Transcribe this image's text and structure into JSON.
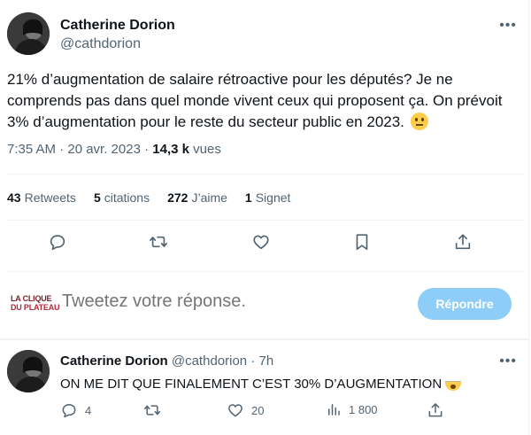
{
  "author": {
    "name": "Catherine Dorion",
    "handle": "@cathdorion"
  },
  "tweet": {
    "text": "21% d’augmentation de salaire rétroactive pour les députés? Je ne comprends pas dans quel monde vivent ceux qui proposent ça. On prévoit 3% d’augmentation pour le reste du secteur public en 2023.",
    "emoji": "neutral-face-emoji",
    "time": "7:35 AM · 20 avr. 2023",
    "separator": "·",
    "views_count": "14,3 k",
    "views_label": "vues"
  },
  "stats": [
    {
      "count": "43",
      "label": "Retweets"
    },
    {
      "count": "5",
      "label": "citations"
    },
    {
      "count": "272",
      "label": "J’aime"
    },
    {
      "count": "1",
      "label": "Signet"
    }
  ],
  "actions": [
    "reply-icon",
    "retweet-icon",
    "like-icon",
    "bookmark-icon",
    "share-icon"
  ],
  "more_label": "•••",
  "reply_box": {
    "logo_line1": "LA CLIQUE",
    "logo_line2": "DU PLATEAU",
    "placeholder": "Tweetez votre réponse.",
    "button_label": "Répondre"
  },
  "reply_tweet": {
    "name": "Catherine Dorion",
    "handle": "@cathdorion",
    "time": "· 7h",
    "text": "ON ME DIT QUE FINALEMENT C’EST 30% D’AUGMENTATION",
    "emoji": "exploding-head-emoji",
    "replies": "4",
    "retweets": "",
    "likes": "20",
    "views": "1 800"
  },
  "colors": {
    "text": "#0f1419",
    "secondary": "#536471",
    "button_disabled": "#8ecdf7",
    "divider": "#eff3f4"
  }
}
